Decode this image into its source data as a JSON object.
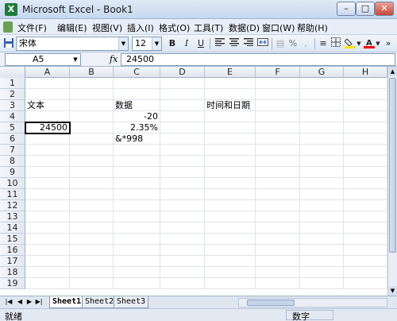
{
  "window": {
    "title": "Microsoft Excel - Book1",
    "app_icon": "X",
    "min": "–",
    "max": "□",
    "close": "✕"
  },
  "menu": [
    "文件(F)",
    "编辑(E)",
    "视图(V)",
    "插入(I)",
    "格式(O)",
    "工具(T)",
    "数据(D)",
    "窗口(W)",
    "帮助(H)"
  ],
  "toolbar": {
    "font": "宋体",
    "size": "12",
    "bold": "B",
    "italic": "I",
    "underline": "U",
    "percent": "%"
  },
  "formula_bar": {
    "cell_ref": "A5",
    "fx": "fx",
    "value": "24500"
  },
  "columns": [
    "A",
    "B",
    "C",
    "D",
    "E",
    "F",
    "G",
    "H"
  ],
  "rows": [
    "1",
    "2",
    "3",
    "4",
    "5",
    "6",
    "7",
    "8",
    "9",
    "10",
    "11",
    "12",
    "13",
    "14",
    "15",
    "16",
    "17",
    "18",
    "19"
  ],
  "cells": [
    {
      "row": 3,
      "col": "A",
      "text": "文本",
      "align": "left"
    },
    {
      "row": 3,
      "col": "C",
      "text": "数据",
      "align": "left"
    },
    {
      "row": 3,
      "col": "E",
      "text": "时间和日期",
      "align": "left"
    },
    {
      "row": 4,
      "col": "C",
      "text": "-20",
      "align": "right"
    },
    {
      "row": 5,
      "col": "A",
      "text": "24500",
      "align": "right"
    },
    {
      "row": 5,
      "col": "C",
      "text": "2.35%",
      "align": "right"
    },
    {
      "row": 6,
      "col": "C",
      "text": "&*998",
      "align": "left"
    }
  ],
  "selected_cell": {
    "row": 5,
    "col": "A"
  },
  "sheets": [
    "Sheet1",
    "Sheet2",
    "Sheet3"
  ],
  "active_sheet": "Sheet1",
  "status": {
    "left": "就绪",
    "right": "数字"
  }
}
